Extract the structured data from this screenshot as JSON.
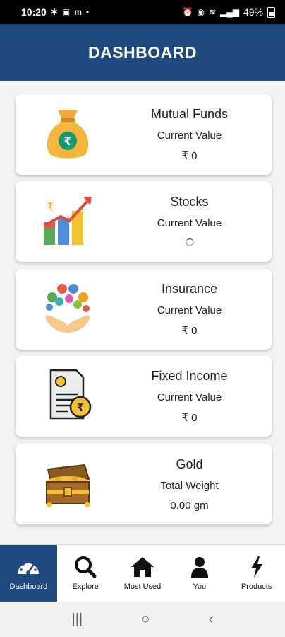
{
  "status": {
    "time": "10:20",
    "battery": "49%",
    "left_icons": [
      "fan-icon",
      "gallery-icon",
      "m-icon",
      "dot-icon"
    ],
    "right_icons": [
      "alarm-icon",
      "hotspot-icon",
      "wifi-icon",
      "signal-icon"
    ]
  },
  "header": {
    "title": "DASHBOARD"
  },
  "cards": [
    {
      "title": "Mutual Funds",
      "subtitle": "Current Value",
      "value": "₹ 0",
      "icon": "money-bag-icon"
    },
    {
      "title": "Stocks",
      "subtitle": "Current Value",
      "value": "",
      "loading": true,
      "icon": "bar-chart-icon"
    },
    {
      "title": "Insurance",
      "subtitle": "Current Value",
      "value": "₹ 0",
      "icon": "insurance-hands-icon"
    },
    {
      "title": "Fixed Income",
      "subtitle": "Current Value",
      "value": "₹ 0",
      "icon": "certificate-icon"
    },
    {
      "title": "Gold",
      "subtitle": "Total Weight",
      "value": "0.00 gm",
      "icon": "treasure-chest-icon"
    }
  ],
  "nav": [
    {
      "label": "Dashboard",
      "icon": "speedometer-icon",
      "active": true
    },
    {
      "label": "Explore",
      "icon": "search-icon",
      "active": false
    },
    {
      "label": "Most Used",
      "icon": "home-icon",
      "active": false
    },
    {
      "label": "You",
      "icon": "person-icon",
      "active": false
    },
    {
      "label": "Products",
      "icon": "bolt-icon",
      "active": false
    }
  ],
  "colors": {
    "primary": "#1e4a80",
    "background": "#f3f3f3",
    "card": "#ffffff"
  }
}
